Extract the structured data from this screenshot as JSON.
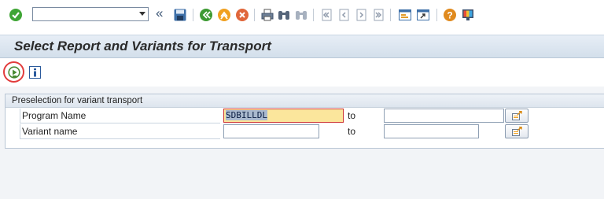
{
  "toolbar": {
    "command_field_value": "",
    "icons": [
      "check-icon",
      "double-left-icon",
      "save-icon",
      "back-icon",
      "exit-icon",
      "cancel-icon",
      "print-icon",
      "find-icon",
      "find-next-icon",
      "first-page-icon",
      "previous-page-icon",
      "next-page-icon",
      "last-page-icon",
      "new-session-icon",
      "shortcut-icon",
      "help-icon",
      "customize-layout-icon"
    ],
    "double_left_glyph": "«"
  },
  "title": "Select Report and Variants for Transport",
  "app_toolbar": {
    "icons": [
      "execute-icon",
      "info-icon"
    ],
    "highlight_color": "#e23c3c"
  },
  "group": {
    "header": "Preselection for variant transport",
    "rows": [
      {
        "label": "Program Name",
        "from_value": "SDBILLDL",
        "to_label": "to",
        "to_value": ""
      },
      {
        "label": "Variant name",
        "from_value": "",
        "to_label": "to",
        "to_value": ""
      }
    ]
  },
  "colors": {
    "title_bar": "#d3dfeb",
    "active_field": "#fbe69c",
    "selection": "#a9b9ce"
  }
}
